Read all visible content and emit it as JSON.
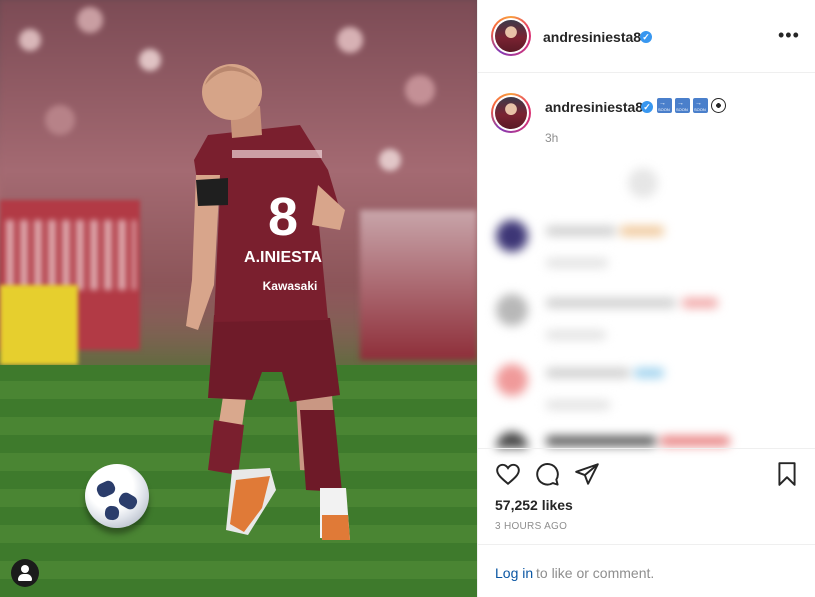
{
  "post": {
    "username": "andresiniesta8",
    "caption_badges": [
      "SOON",
      "SOON",
      "SOON"
    ],
    "caption_time": "3h",
    "likes": "57,252 likes",
    "posted_ago": "3 HOURS AGO"
  },
  "photo": {
    "jersey_number": "8",
    "jersey_name": "A.INIESTA",
    "sponsor": "Kawasaki"
  },
  "footer": {
    "login_label": "Log in",
    "login_suffix": "to like or comment."
  },
  "icons": {
    "more": "more-options-icon",
    "like": "heart-icon",
    "comment": "comment-icon",
    "share": "share-icon",
    "save": "bookmark-icon",
    "verified": "verified-icon",
    "profile": "user-icon"
  },
  "colors": {
    "verified": "#3897f0",
    "link": "#0a56a3",
    "muted": "#8e8e8e",
    "jersey": "#7a1f2e"
  }
}
